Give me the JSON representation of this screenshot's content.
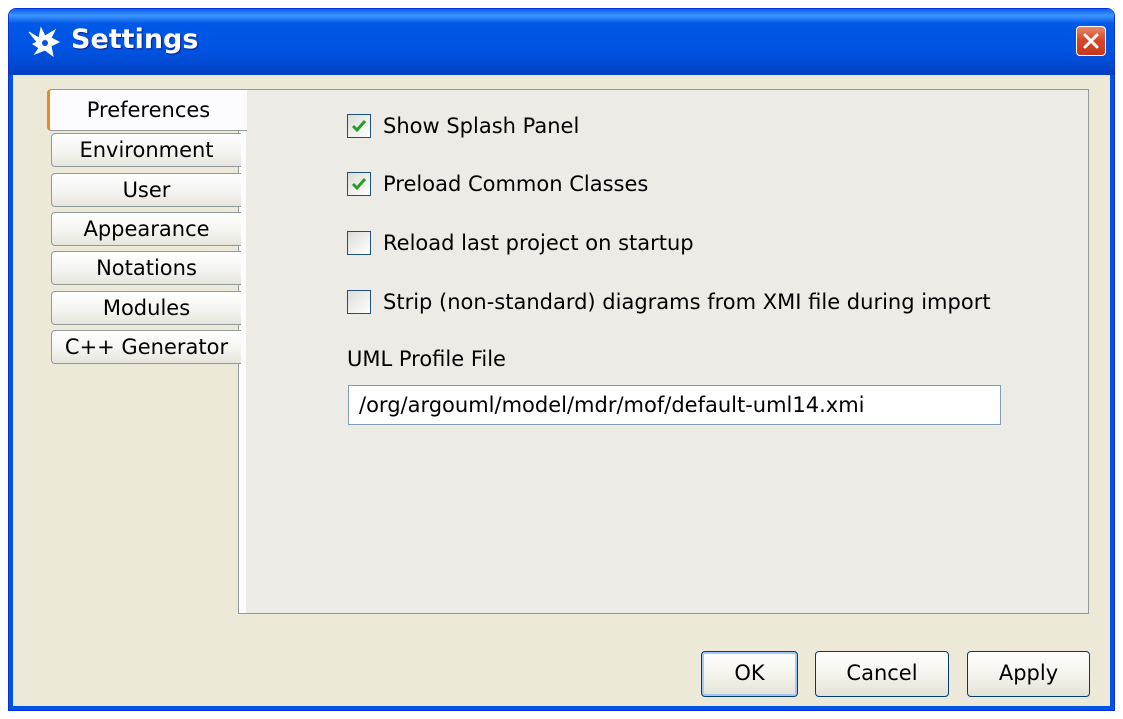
{
  "window": {
    "title": "Settings",
    "icon": "argouml-logo-icon",
    "close_icon": "close-icon"
  },
  "tabs": [
    {
      "label": "Preferences",
      "active": true
    },
    {
      "label": "Environment",
      "active": false
    },
    {
      "label": "User",
      "active": false
    },
    {
      "label": "Appearance",
      "active": false
    },
    {
      "label": "Notations",
      "active": false
    },
    {
      "label": "Modules",
      "active": false
    },
    {
      "label": "C++ Generator",
      "active": false
    }
  ],
  "preferences": {
    "options": [
      {
        "label": "Show Splash Panel",
        "checked": true
      },
      {
        "label": "Preload Common Classes",
        "checked": true
      },
      {
        "label": "Reload last project on startup",
        "checked": false
      },
      {
        "label": "Strip (non-standard) diagrams from XMI file during import",
        "checked": false
      }
    ],
    "profile_label": "UML Profile File",
    "profile_value": "/org/argouml/model/mdr/mof/default-uml14.xmi"
  },
  "buttons": {
    "ok": "OK",
    "cancel": "Cancel",
    "apply": "Apply"
  },
  "colors": {
    "titlebar": "#0054e3",
    "dialog_bg": "#ece9d8",
    "tab_accent": "#e68b2c",
    "check_mark": "#21a121"
  }
}
